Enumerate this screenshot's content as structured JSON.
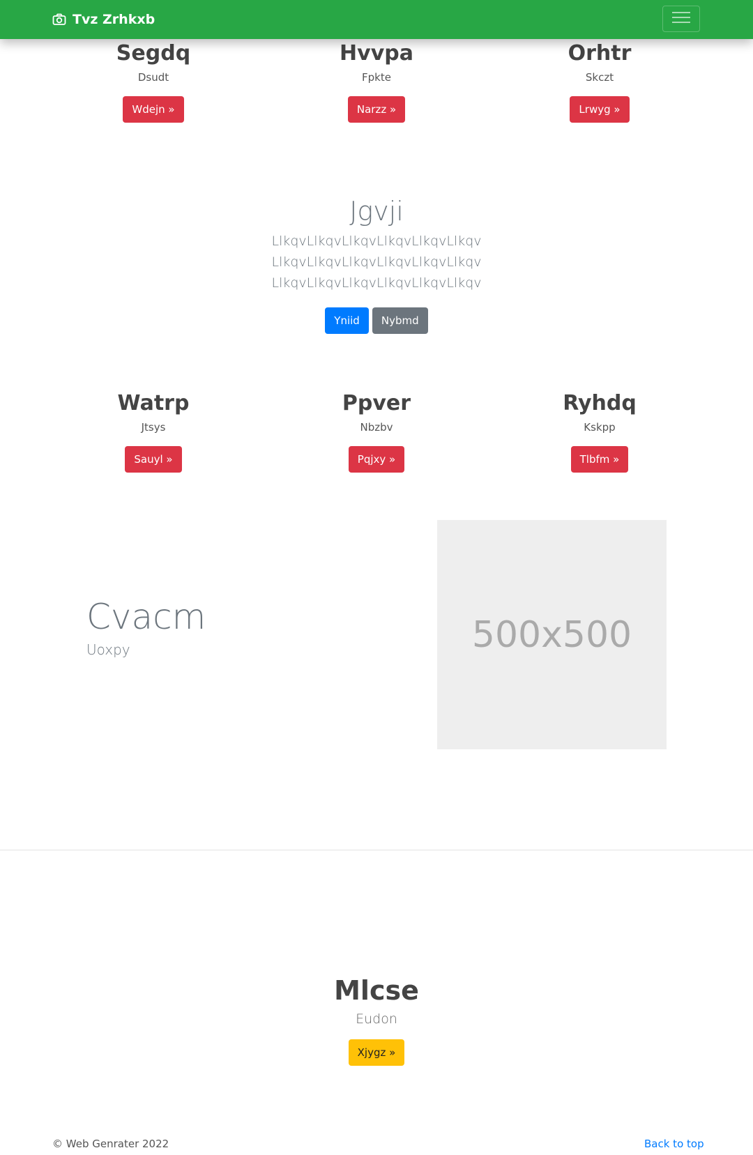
{
  "navbar": {
    "brand": "Tvz Zrhkxb",
    "brand_icon": "camera-icon",
    "toggler_icon": "hamburger-menu-icon",
    "background": "#28a745"
  },
  "features_top": [
    {
      "title": "Segdq",
      "text": "Dsudt",
      "button": "Wdejn »"
    },
    {
      "title": "Hvvpa",
      "text": "Fpkte",
      "button": "Narzz »"
    },
    {
      "title": "Orhtr",
      "text": "Skczt",
      "button": "Lrwyg »"
    }
  ],
  "hero": {
    "title": "Jgvji",
    "text": "LlkqvLlkqvLlkqvLlkqvLlkqvLlkqv LlkqvLlkqvLlkqvLlkqvLlkqvLlkqv LlkqvLlkqvLlkqvLlkqvLlkqvLlkqv",
    "primary_button": "Yniid",
    "secondary_button": "Nybmd"
  },
  "features_mid": [
    {
      "title": "Watrp",
      "text": "Jtsys",
      "button": "Sauyl »"
    },
    {
      "title": "Ppver",
      "text": "Nbzbv",
      "button": "Pqjxy »"
    },
    {
      "title": "Ryhdq",
      "text": "Kskpp",
      "button": "Tlbfm »"
    }
  ],
  "feature": {
    "title": "Cvacm",
    "subtitle": "Uoxpy",
    "image_label": "500x500"
  },
  "bottom": {
    "title": "Mlcse",
    "text": "Eudon",
    "button": "Xjygz »"
  },
  "footer": {
    "copyright": "© Web Genrater 2022",
    "back_to_top": "Back to top"
  },
  "colors": {
    "danger": "#dc3545",
    "primary": "#007bff",
    "secondary": "#6c757d",
    "warning": "#ffc107"
  }
}
